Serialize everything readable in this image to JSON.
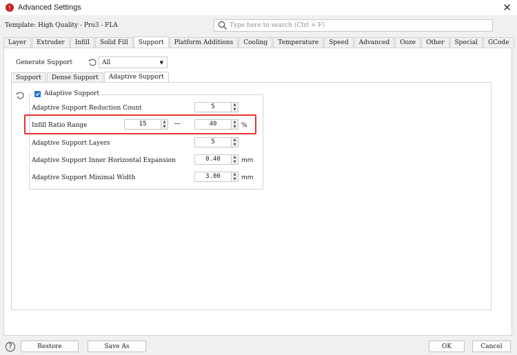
{
  "window": {
    "title": "Advanced Settings",
    "app_icon_glyph": "!"
  },
  "template": {
    "label": "Template: High Quality - Pro3 - FLA"
  },
  "search": {
    "placeholder": "Type here to search (Ctrl + F)"
  },
  "main_tabs": [
    "Layer",
    "Extruder",
    "Infill",
    "Solid Fill",
    "Support",
    "Platform Additions",
    "Cooling",
    "Temperature",
    "Speed",
    "Advanced",
    "Ooze",
    "Other",
    "Special",
    "GCode"
  ],
  "active_main_tab": "Support",
  "generate_support": {
    "label": "Generate Support",
    "value": "All"
  },
  "sub_tabs": [
    "Support",
    "Dense Support",
    "Adaptive Support"
  ],
  "active_sub_tab": "Adaptive Support",
  "adaptive": {
    "group_label": "Adaptive Support",
    "checked": true,
    "reduction_count": {
      "label": "Adaptive Support Reduction Count",
      "value": "5"
    },
    "infill_ratio_range": {
      "label": "Infill Ratio Range",
      "min": "15",
      "max": "40",
      "separator": "—",
      "unit": "%"
    },
    "layers": {
      "label": "Adaptive Support Layers",
      "value": "5"
    },
    "inner_expansion": {
      "label": "Adaptive Support Inner Horizontal Expansion",
      "value": "0.40",
      "unit": "mm"
    },
    "minimal_width": {
      "label": "Adaptive Support Minimal Width",
      "value": "3.00",
      "unit": "mm"
    }
  },
  "buttons": {
    "restore": "Restore",
    "save_as": "Save As",
    "ok": "OK",
    "cancel": "Cancel",
    "help": "?"
  },
  "colors": {
    "highlight": "#e8332a",
    "checkbox": "#1f6fd1",
    "app_icon": "#c8201c"
  }
}
